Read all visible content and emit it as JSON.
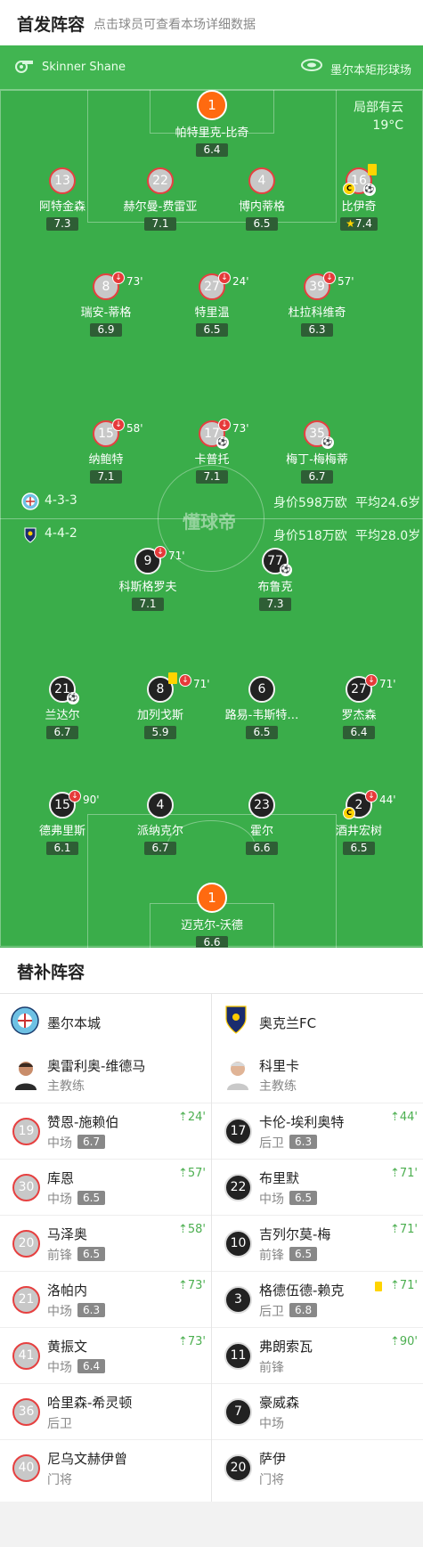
{
  "header": {
    "title": "首发阵容",
    "subtitle": "点击球员可查看本场详细数据"
  },
  "info": {
    "referee": "Skinner Shane",
    "venue": "墨尔本矩形球场",
    "weather": "局部有云",
    "temperature": "19°C"
  },
  "home": {
    "formation": "4-3-3",
    "value": "身价598万欧",
    "avg_age": "平均24.6岁",
    "gk": {
      "num": "1",
      "name": "帕特里克-比奇",
      "rating": "6.4"
    },
    "def": [
      {
        "num": "13",
        "name": "阿特金森",
        "rating": "7.3"
      },
      {
        "num": "22",
        "name": "赫尔曼-费雷亚",
        "rating": "7.1"
      },
      {
        "num": "4",
        "name": "博内蒂格",
        "rating": "6.5"
      },
      {
        "num": "16",
        "name": "比伊奇",
        "rating": "7.4"
      }
    ],
    "mid": [
      {
        "num": "8",
        "name": "瑞安-蒂格",
        "rating": "6.9",
        "sub_min": "73'"
      },
      {
        "num": "27",
        "name": "特里温",
        "rating": "6.5",
        "sub_min": "24'"
      },
      {
        "num": "39",
        "name": "杜拉科维奇",
        "rating": "6.3",
        "sub_min": "57'"
      }
    ],
    "fwd": [
      {
        "num": "15",
        "name": "纳鲍特",
        "rating": "7.1",
        "sub_min": "58'"
      },
      {
        "num": "17",
        "name": "卡普托",
        "rating": "7.1",
        "sub_min": "73'"
      },
      {
        "num": "35",
        "name": "梅丁-梅梅蒂",
        "rating": "6.7"
      }
    ]
  },
  "away": {
    "formation": "4-4-2",
    "value": "身价518万欧",
    "avg_age": "平均28.0岁",
    "fwd": [
      {
        "num": "9",
        "name": "科斯格罗夫",
        "rating": "7.1",
        "sub_min": "71'"
      },
      {
        "num": "77",
        "name": "布鲁克",
        "rating": "7.3"
      }
    ],
    "mid": [
      {
        "num": "21",
        "name": "兰达尔",
        "rating": "6.7"
      },
      {
        "num": "8",
        "name": "加列戈斯",
        "rating": "5.9",
        "sub_min": "71'"
      },
      {
        "num": "6",
        "name": "路易-韦斯特…",
        "rating": "6.5"
      },
      {
        "num": "27",
        "name": "罗杰森",
        "rating": "6.4",
        "sub_min": "71'"
      }
    ],
    "def": [
      {
        "num": "15",
        "name": "德弗里斯",
        "rating": "6.1",
        "sub_min": "90'"
      },
      {
        "num": "4",
        "name": "派纳克尔",
        "rating": "6.7"
      },
      {
        "num": "23",
        "name": "霍尔",
        "rating": "6.6"
      },
      {
        "num": "2",
        "name": "酒井宏树",
        "rating": "6.5",
        "sub_min": "44'"
      }
    ],
    "gk": {
      "num": "1",
      "name": "迈克尔-沃德",
      "rating": "6.6"
    }
  },
  "watermark": "懂球帝",
  "subs": {
    "title": "替补阵容",
    "home_team": "墨尔本城",
    "away_team": "奥克兰FC",
    "home_coach": {
      "name": "奥雷利奥-维德马",
      "role": "主教练"
    },
    "away_coach": {
      "name": "科里卡",
      "role": "主教练"
    },
    "home_list": [
      {
        "num": "19",
        "name": "赞恩-施赖伯",
        "pos": "中场",
        "rating": "6.7",
        "in": "24'"
      },
      {
        "num": "30",
        "name": "库恩",
        "pos": "中场",
        "rating": "6.5",
        "in": "57'"
      },
      {
        "num": "20",
        "name": "马泽奥",
        "pos": "前锋",
        "rating": "6.5",
        "in": "58'"
      },
      {
        "num": "21",
        "name": "洛帕内",
        "pos": "中场",
        "rating": "6.3",
        "in": "73'"
      },
      {
        "num": "41",
        "name": "黄振文",
        "pos": "中场",
        "rating": "6.4",
        "in": "73'"
      },
      {
        "num": "36",
        "name": "哈里森-希灵顿",
        "pos": "后卫"
      },
      {
        "num": "40",
        "name": "尼乌文赫伊曾",
        "pos": "门将"
      }
    ],
    "away_list": [
      {
        "num": "17",
        "name": "卡伦-埃利奥特",
        "pos": "后卫",
        "rating": "6.3",
        "in": "44'"
      },
      {
        "num": "22",
        "name": "布里默",
        "pos": "中场",
        "rating": "6.5",
        "in": "71'"
      },
      {
        "num": "10",
        "name": "吉列尔莫-梅",
        "pos": "前锋",
        "rating": "6.5",
        "in": "71'"
      },
      {
        "num": "3",
        "name": "格德伍德-赖克",
        "pos": "后卫",
        "rating": "6.8",
        "in": "71'"
      },
      {
        "num": "11",
        "name": "弗朗索瓦",
        "pos": "前锋",
        "in": "90'"
      },
      {
        "num": "7",
        "name": "豪威森",
        "pos": "中场"
      },
      {
        "num": "20",
        "name": "萨伊",
        "pos": "门将"
      }
    ]
  }
}
